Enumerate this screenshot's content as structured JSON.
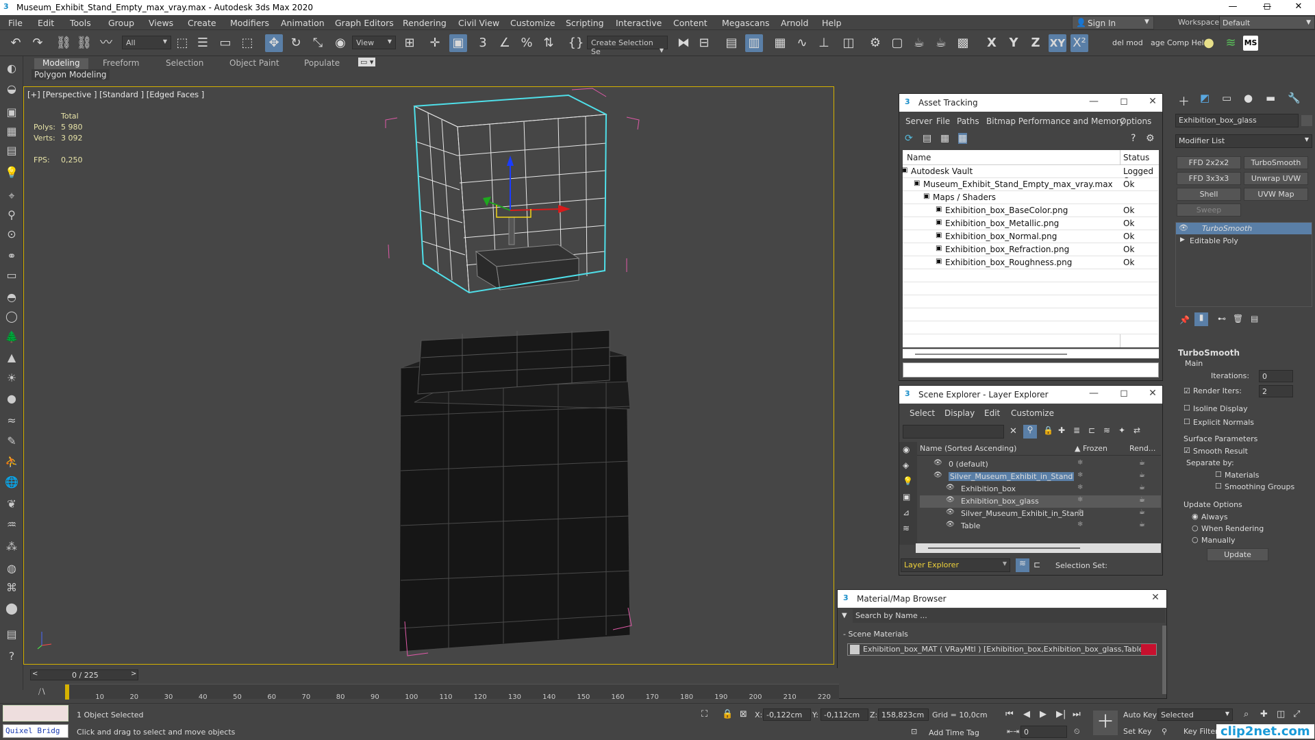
{
  "window": {
    "title": "Museum_Exhibit_Stand_Empty_max_vray.max - Autodesk 3ds Max 2020",
    "min": "—",
    "max": "◻",
    "close": "✕"
  },
  "menu": [
    "File",
    "Edit",
    "Tools",
    "Group",
    "Views",
    "Create",
    "Modifiers",
    "Animation",
    "Graph Editors",
    "Rendering",
    "Civil View",
    "Customize",
    "Scripting",
    "Interactive",
    "Content",
    "Megascans",
    "Arnold",
    "Help"
  ],
  "header": {
    "signin": "Sign In",
    "workspaces_label": "Workspaces:",
    "workspace": "Default"
  },
  "toolbar": {
    "filter": "All",
    "refcoord": "View",
    "selset": "Create Selection Se",
    "axes": [
      "X",
      "Y",
      "Z",
      "XY"
    ],
    "delmod": "del mod",
    "agecomp": "age Comp Hel"
  },
  "ribbon": {
    "tabs": [
      "Modeling",
      "Freeform",
      "Selection",
      "Object Paint",
      "Populate"
    ],
    "sub": "Polygon Modeling"
  },
  "viewport": {
    "label": "[+] [Perspective ] [Standard ] [Edged Faces ]",
    "total": "Total",
    "polys_label": "Polys:",
    "polys": "5 980",
    "verts_label": "Verts:",
    "verts": "3 092",
    "fps_label": "FPS:",
    "fps": "0,250"
  },
  "asset": {
    "title": "Asset Tracking",
    "menu": [
      "Server",
      "File",
      "Paths",
      "Bitmap Performance and Memory",
      "Options"
    ],
    "col_name": "Name",
    "col_status": "Status",
    "rows": [
      {
        "name": "Autodesk Vault",
        "status": "Logged O",
        "indent": 12
      },
      {
        "name": "Museum_Exhibit_Stand_Empty_max_vray.max",
        "status": "Ok",
        "indent": 30
      },
      {
        "name": "Maps / Shaders",
        "status": "",
        "indent": 44
      },
      {
        "name": "Exhibition_box_BaseColor.png",
        "status": "Ok",
        "indent": 62
      },
      {
        "name": "Exhibition_box_Metallic.png",
        "status": "Ok",
        "indent": 62
      },
      {
        "name": "Exhibition_box_Normal.png",
        "status": "Ok",
        "indent": 62
      },
      {
        "name": "Exhibition_box_Refraction.png",
        "status": "Ok",
        "indent": 62
      },
      {
        "name": "Exhibition_box_Roughness.png",
        "status": "Ok",
        "indent": 62
      }
    ]
  },
  "layer": {
    "title": "Scene Explorer - Layer Explorer",
    "menu": [
      "Select",
      "Display",
      "Edit",
      "Customize"
    ],
    "col_name": "Name (Sorted Ascending)",
    "col_frozen": "▲ Frozen",
    "col_render": "Rend...",
    "rows": [
      {
        "name": "0 (default)",
        "indent": 38
      },
      {
        "name": "Silver_Museum_Exhibit_in_Stand",
        "indent": 38
      },
      {
        "name": "Exhibition_box",
        "indent": 56
      },
      {
        "name": "Exhibition_box_glass",
        "indent": 56
      },
      {
        "name": "Silver_Museum_Exhibit_in_Stand",
        "indent": 56
      },
      {
        "name": "Table",
        "indent": 56
      }
    ],
    "footer": "Layer Explorer",
    "selset": "Selection Set:"
  },
  "matbrowser": {
    "title": "Material/Map Browser",
    "search": "Search by Name ...",
    "section": "- Scene Materials",
    "item": "Exhibition_box_MAT ( VRayMtl ) [Exhibition_box,Exhibition_box_glass,Table]"
  },
  "cmd": {
    "objname": "Exhibition_box_glass",
    "modlist": "Modifier List",
    "btns": [
      "FFD 2x2x2",
      "TurboSmooth",
      "FFD 3x3x3",
      "Unwrap UVW",
      "Shell",
      "UVW Map",
      "Sweep"
    ],
    "stack": [
      "TurboSmooth",
      "Editable Poly"
    ],
    "ts_title": "TurboSmooth",
    "main": "Main",
    "iterations_label": "Iterations:",
    "iterations": "0",
    "render_iters_label": "Render Iters:",
    "render_iters": "2",
    "isoline": "Isoline Display",
    "explicit": "Explicit Normals",
    "surface": "Surface Parameters",
    "smooth": "Smooth Result",
    "separate": "Separate by:",
    "materials": "Materials",
    "smoothing": "Smoothing Groups",
    "update_opts": "Update Options",
    "always": "Always",
    "when_rendering": "When Rendering",
    "manually": "Manually",
    "update": "Update"
  },
  "timeline": {
    "frame": "0 / 225",
    "ticks": [
      "10",
      "20",
      "30",
      "40",
      "50",
      "60",
      "70",
      "80",
      "90",
      "100",
      "110",
      "120",
      "130",
      "140",
      "150",
      "160",
      "170",
      "180",
      "190",
      "200",
      "210",
      "220"
    ]
  },
  "status": {
    "quixel": "Quixel Bridg",
    "selected": "1 Object Selected",
    "hint": "Click and drag to select and move objects",
    "x_label": "X:",
    "x": "-0,122cm",
    "y_label": "Y:",
    "y": "-0,112cm",
    "z_label": "Z:",
    "z": "158,823cm",
    "grid": "Grid = 10,0cm",
    "addtime": "Add Time Tag",
    "autokey": "Auto Key",
    "setkey": "Set Key",
    "selected_mode": "Selected",
    "keyfilters": "Key Filters...",
    "frame": "0",
    "watermark": "clip2net.com"
  }
}
